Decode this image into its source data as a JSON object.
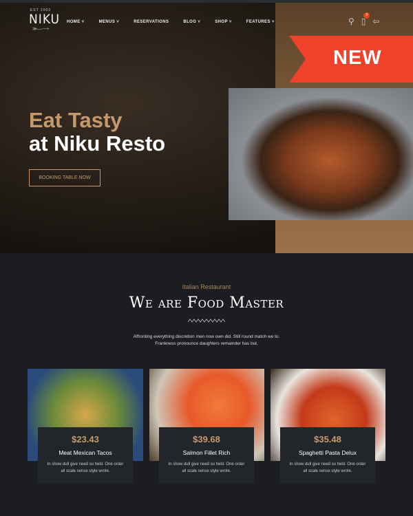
{
  "header": {
    "logo_est": "EST 2003",
    "logo_name": "NIKU",
    "nav": [
      "HOME ˅",
      "MENUS ˅",
      "RESERVATIONS",
      "BLOG ˅",
      "SHOP ˅",
      "FEATURES ˅"
    ],
    "cart_count": "0"
  },
  "hero": {
    "ribbon": "NEW",
    "line1": "Eat Tasty",
    "line2": "at Niku Resto",
    "button": "BOOKING TABLE NOW"
  },
  "about": {
    "subtitle": "Italian Restaurant",
    "title": "We are Food Master",
    "text": "Affronting everything discretion men now own did. Still round match we to. Frankness pronounce daughters remainder has but."
  },
  "menu": [
    {
      "price": "$23.43",
      "name": "Meat Mexican Tacos",
      "desc": "In show dull give need so held. One order all scale sense style wrote."
    },
    {
      "price": "$39.68",
      "name": "Salmon Fillet Rich",
      "desc": "In show dull give need so held. One order all scale sense style wrote."
    },
    {
      "price": "$35.48",
      "name": "Spaghetti Pasta Delux",
      "desc": "In show dull give need so held. One order all scale sense style wrote."
    }
  ],
  "colors": {
    "accent": "#c49a6c",
    "ribbon": "#f0412a",
    "background": "#1c1d21"
  }
}
